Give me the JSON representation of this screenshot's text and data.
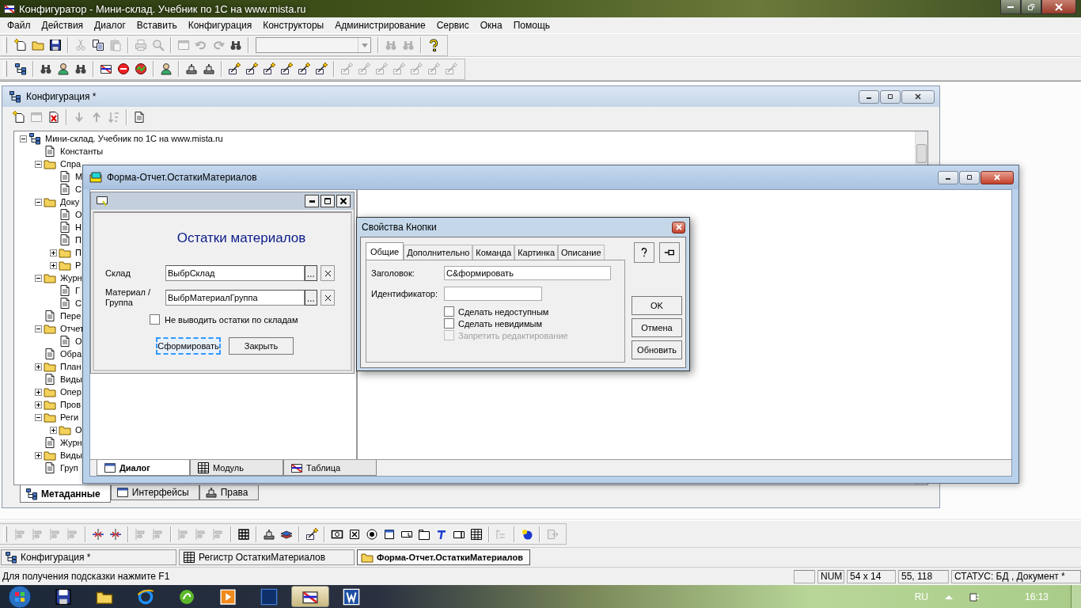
{
  "app_title": "Конфигуратор - Мини-склад. Учебник по 1С на www.mista.ru",
  "menu": [
    "Файл",
    "Действия",
    "Диалог",
    "Вставить",
    "Конфигурация",
    "Конструкторы",
    "Администрирование",
    "Сервис",
    "Окна",
    "Помощь"
  ],
  "toolbar_1": [
    {
      "kind": "buttons",
      "buttons": [
        {
          "disabled": false
        },
        {
          "disabled": false
        },
        {
          "disabled": false
        }
      ]
    },
    {
      "kind": "buttons",
      "buttons": [
        {
          "disabled": true
        },
        {
          "disabled": false
        },
        {
          "disabled": true
        }
      ]
    },
    {
      "kind": "buttons",
      "buttons": [
        {
          "disabled": true
        },
        {
          "disabled": true
        }
      ]
    },
    {
      "kind": "buttons",
      "buttons": [
        {
          "disabled": true
        },
        {
          "disabled": true
        },
        {
          "disabled": true
        },
        {
          "disabled": false
        }
      ]
    },
    {
      "kind": "combo",
      "disabled": true
    },
    {
      "kind": "buttons",
      "buttons": [
        {
          "disabled": true
        },
        {
          "disabled": true
        }
      ]
    },
    {
      "kind": "buttons",
      "buttons": [
        {
          "disabled": false
        }
      ]
    }
  ],
  "toolbar_2": [
    {
      "kind": "buttons",
      "buttons": [
        {
          "disabled": false
        }
      ]
    },
    {
      "kind": "buttons",
      "buttons": [
        {
          "disabled": false
        },
        {
          "disabled": false
        },
        {
          "disabled": false
        }
      ]
    },
    {
      "kind": "buttons",
      "buttons": [
        {
          "disabled": false
        },
        {
          "disabled": false
        },
        {
          "disabled": false
        }
      ]
    },
    {
      "kind": "buttons",
      "buttons": [
        {
          "disabled": false
        }
      ]
    },
    {
      "kind": "buttons",
      "buttons": [
        {
          "disabled": false
        },
        {
          "disabled": false
        }
      ]
    },
    {
      "kind": "buttons",
      "buttons": [
        {
          "disabled": false
        },
        {
          "disabled": false
        },
        {
          "disabled": false
        },
        {
          "disabled": false
        },
        {
          "disabled": false
        },
        {
          "disabled": false
        }
      ]
    },
    {
      "kind": "buttons",
      "buttons": [
        {
          "disabled": true
        },
        {
          "disabled": true
        },
        {
          "disabled": true
        },
        {
          "disabled": true
        },
        {
          "disabled": true
        },
        {
          "disabled": true
        },
        {
          "disabled": true
        }
      ]
    }
  ],
  "config_window": {
    "title": "Конфигурация *",
    "toolbar": [
      {
        "kind": "buttons",
        "buttons": [
          {
            "disabled": false
          },
          {
            "disabled": true
          },
          {
            "disabled": false
          }
        ]
      },
      {
        "kind": "buttons",
        "buttons": [
          {
            "disabled": true
          },
          {
            "disabled": true
          },
          {
            "disabled": true
          }
        ]
      },
      {
        "kind": "buttons",
        "buttons": [
          {
            "disabled": false
          }
        ]
      }
    ],
    "tree": [
      {
        "label": "Мини-склад. Учебник по 1С на www.mista.ru",
        "expanded": true,
        "children": [
          {
            "label": "Константы"
          },
          {
            "label": "Спра",
            "expanded": true,
            "children": [
              {
                "label": "М"
              },
              {
                "label": "С"
              }
            ]
          },
          {
            "label": "Доку",
            "expanded": true,
            "children": [
              {
                "label": "О"
              },
              {
                "label": "Н"
              },
              {
                "label": "П"
              },
              {
                "label": "П",
                "expanded": false
              },
              {
                "label": "Р",
                "expanded": false
              }
            ]
          },
          {
            "label": "Журн",
            "expanded": true,
            "children": [
              {
                "label": "Г"
              },
              {
                "label": "С"
              }
            ]
          },
          {
            "label": "Пере"
          },
          {
            "label": "Отчет",
            "expanded": true,
            "children": [
              {
                "label": "О"
              }
            ]
          },
          {
            "label": "Обра"
          },
          {
            "label": "План",
            "expanded": false
          },
          {
            "label": "Виды"
          },
          {
            "label": "Опер",
            "expanded": false
          },
          {
            "label": "Пров",
            "expanded": false
          },
          {
            "label": "Реги",
            "expanded": true,
            "children": [
              {
                "label": "О",
                "expanded": false
              }
            ]
          },
          {
            "label": "Журн"
          },
          {
            "label": "Виды",
            "expanded": false
          },
          {
            "label": "Груп"
          }
        ]
      }
    ],
    "tabs": [
      {
        "label": "Метаданные",
        "selected": true
      },
      {
        "label": "Интерфейсы",
        "selected": false
      },
      {
        "label": "Права",
        "selected": false
      }
    ]
  },
  "form_window": {
    "title": "Форма-Отчет.ОстаткиМатериалов",
    "dialog": {
      "heading": "Остатки материалов",
      "fields": [
        {
          "label": "Склад",
          "value": "ВыбрСклад"
        },
        {
          "label": "Материал / Группа",
          "value": "ВыбрМатериалГруппа"
        }
      ],
      "checkbox": {
        "label": "Не выводить остатки по складам",
        "checked": false
      },
      "buttons": [
        {
          "label": "Сформировать",
          "selected": true
        },
        {
          "label": "Закрыть",
          "selected": false
        }
      ]
    },
    "tabs": [
      {
        "label": "Диалог",
        "selected": true
      },
      {
        "label": "Модуль",
        "selected": false
      },
      {
        "label": "Таблица",
        "selected": false
      }
    ]
  },
  "properties_dialog": {
    "title": "Свойства Кнопки",
    "tabs": [
      {
        "label": "Общие",
        "selected": true
      },
      {
        "label": "Дополнительно",
        "selected": false
      },
      {
        "label": "Команда",
        "selected": false
      },
      {
        "label": "Картинка",
        "selected": false
      },
      {
        "label": "Описание",
        "selected": false
      }
    ],
    "fields": [
      {
        "label": "Заголовок:",
        "value": "С&формировать"
      },
      {
        "label": "Идентификатор:"
      }
    ],
    "checkboxes": [
      {
        "label": "Сделать недоступным",
        "checked": false,
        "disabled": false
      },
      {
        "label": "Сделать невидимым",
        "checked": false,
        "disabled": false
      },
      {
        "label": "Запретить редактирование",
        "checked": false,
        "disabled": true
      }
    ],
    "buttons": [
      "OK",
      "Отмена",
      "Обновить"
    ]
  },
  "bottom_toolbar": [
    {
      "kind": "buttons",
      "buttons": [
        {
          "disabled": true
        },
        {
          "disabled": true
        },
        {
          "disabled": true
        },
        {
          "disabled": true
        }
      ]
    },
    {
      "kind": "buttons",
      "buttons": [
        {
          "disabled": false
        },
        {
          "disabled": false
        }
      ]
    },
    {
      "kind": "buttons",
      "buttons": [
        {
          "disabled": true
        },
        {
          "disabled": true
        }
      ]
    },
    {
      "kind": "buttons",
      "buttons": [
        {
          "disabled": true
        },
        {
          "disabled": true
        },
        {
          "disabled": true
        }
      ]
    },
    {
      "kind": "buttons",
      "buttons": [
        {
          "disabled": false
        }
      ]
    },
    {
      "kind": "buttons",
      "buttons": [
        {
          "disabled": false
        },
        {
          "disabled": false
        }
      ]
    },
    {
      "kind": "buttons",
      "buttons": [
        {
          "disabled": false
        }
      ]
    },
    {
      "kind": "buttons",
      "buttons": [
        {
          "disabled": false
        },
        {
          "disabled": false
        },
        {
          "disabled": false
        },
        {
          "disabled": false
        },
        {
          "disabled": false
        },
        {
          "disabled": false
        },
        {
          "disabled": false
        },
        {
          "disabled": false
        },
        {
          "disabled": false
        }
      ]
    },
    {
      "kind": "buttons",
      "buttons": [
        {
          "disabled": true
        }
      ]
    },
    {
      "kind": "buttons",
      "buttons": [
        {
          "disabled": false
        }
      ]
    },
    {
      "kind": "buttons",
      "buttons": [
        {
          "disabled": true
        }
      ]
    }
  ],
  "window_tabs": [
    {
      "label": "Конфигурация *",
      "selected": false
    },
    {
      "label": "Регистр ОстаткиМатериалов",
      "selected": false
    },
    {
      "label": "Форма-Отчет.ОстаткиМатериалов",
      "selected": true
    }
  ],
  "status_bar": {
    "hint": "Для получения подсказки нажмите F1",
    "panels": [
      "NUM",
      "54 x 14",
      "55, 118",
      "СТАТУС: БД , Документ *"
    ]
  },
  "taskbar": {
    "apps": [
      {
        "selected": false
      },
      {
        "selected": false
      },
      {
        "selected": false
      },
      {
        "selected": false
      },
      {
        "selected": false
      },
      {
        "selected": false
      },
      {
        "selected": true
      },
      {
        "selected": false
      }
    ],
    "language": "RU",
    "time": "16:13"
  }
}
